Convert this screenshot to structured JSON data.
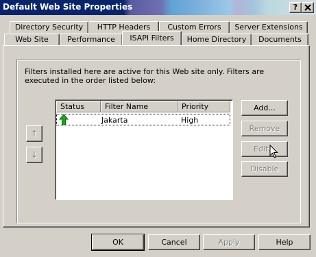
{
  "window": {
    "title": "Default Web Site Properties",
    "help_button": "?",
    "close_button": "X"
  },
  "tabs_back": [
    "Directory Security",
    "HTTP Headers",
    "Custom Errors",
    "Server Extensions"
  ],
  "tabs_front": [
    "Web Site",
    "Performance",
    "ISAPI Filters",
    "Home Directory",
    "Documents"
  ],
  "selected_tab": "ISAPI Filters",
  "description": "Filters installed here are active for this Web site only. Filters are executed in the order listed below:",
  "filter_list": {
    "columns": [
      "Status",
      "Filter Name",
      "Priority"
    ],
    "rows": [
      {
        "status_icon": "green-up-arrow-icon",
        "name": "Jakarta",
        "priority": "High"
      }
    ]
  },
  "move_up_glyph": "↑",
  "move_down_glyph": "↓",
  "side_buttons": {
    "add": "Add...",
    "remove": "Remove",
    "edit": "Edit...",
    "disable": "Disable"
  },
  "bottom_buttons": {
    "ok": "OK",
    "cancel": "Cancel",
    "apply": "Apply",
    "help": "Help"
  },
  "colors": {
    "title_bar": "#0a246a",
    "face": "#d4d0c8",
    "status_arrow": "#1fa31f"
  }
}
